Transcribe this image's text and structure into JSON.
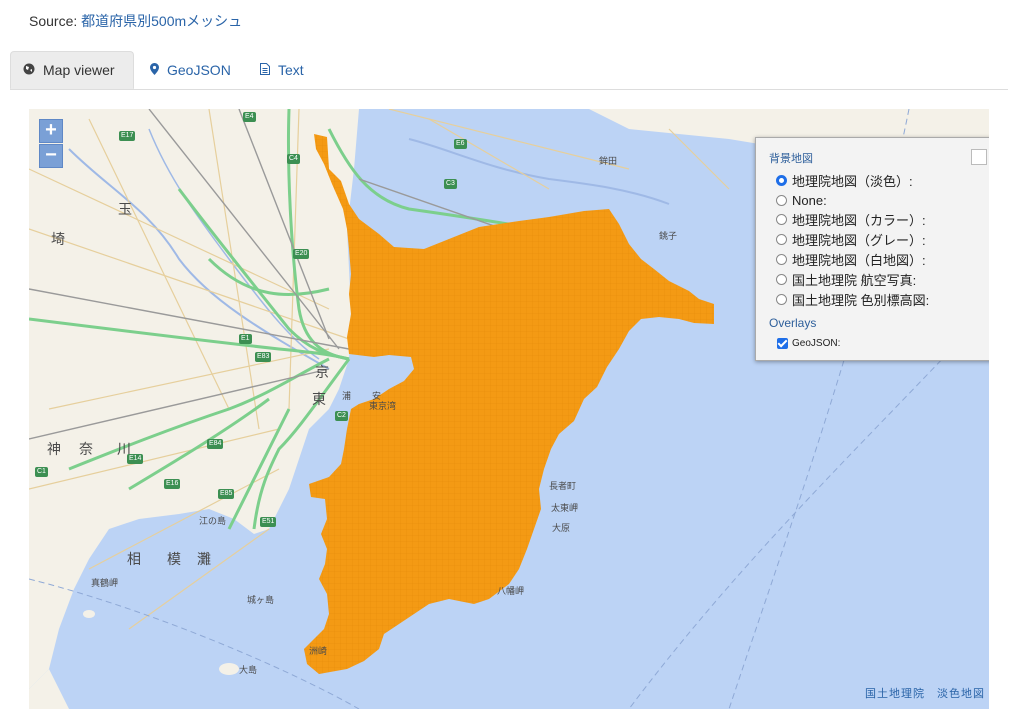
{
  "source": {
    "prefix": "Source: ",
    "link_text": "都道府県別500mメッシュ"
  },
  "tabs": [
    {
      "label": "Map viewer",
      "icon": "globe-icon",
      "active": true
    },
    {
      "label": "GeoJSON",
      "icon": "map-marker-icon",
      "active": false
    },
    {
      "label": "Text",
      "icon": "document-icon",
      "active": false
    }
  ],
  "map": {
    "zoom_in": "+",
    "zoom_out": "−",
    "base_layers_title": "背景地図",
    "base_layers": [
      {
        "label": "地理院地図（淡色）:",
        "selected": true
      },
      {
        "label": "None:",
        "selected": false
      },
      {
        "label": "地理院地図（カラー）:",
        "selected": false
      },
      {
        "label": "地理院地図（グレー）:",
        "selected": false
      },
      {
        "label": "地理院地図（白地図）:",
        "selected": false
      },
      {
        "label": "国土地理院 航空写真:",
        "selected": false
      },
      {
        "label": "国土地理院 色別標高図:",
        "selected": false
      }
    ],
    "overlays_title": "Overlays",
    "overlay": {
      "label": "GeoJSON:",
      "checked": true
    },
    "attribution": "国土地理院　淡色地図",
    "place_labels": [
      "玉",
      "埼",
      "京",
      "東",
      "神",
      "奈",
      "川",
      "浦",
      "安",
      "東京湾",
      "相",
      "模",
      "灘",
      "真鶴岬",
      "江の島",
      "城ヶ島",
      "八幡岬",
      "太東岬",
      "大原",
      "長者町",
      "鉾田",
      "銚子",
      "洲崎",
      "大島"
    ],
    "road_shields": [
      "E17",
      "E4",
      "E6",
      "C4",
      "C3",
      "E20",
      "E1",
      "E83",
      "C2",
      "E84",
      "E85",
      "E16",
      "E14",
      "E51",
      "C1"
    ],
    "colors": {
      "sea": "#bcd3f5",
      "land": "#f4f1e8",
      "overlay": "#f49a14",
      "expressway": "#7ccf8c",
      "road": "#e8d3a3"
    }
  }
}
